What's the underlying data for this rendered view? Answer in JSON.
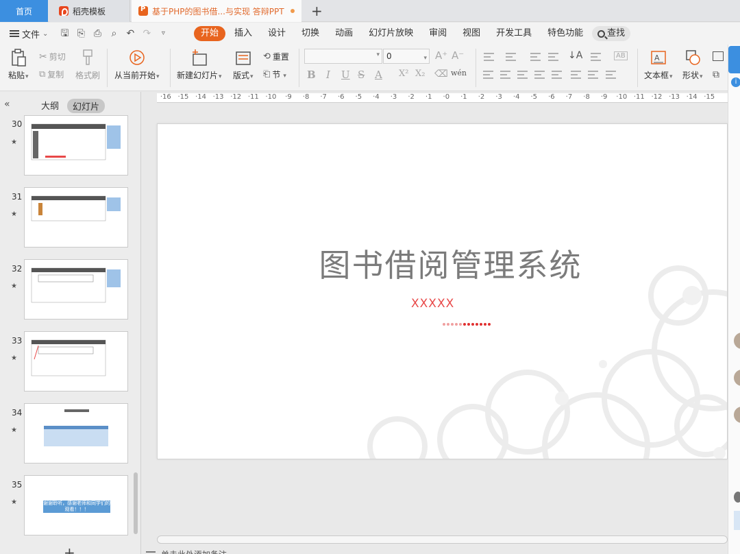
{
  "tabs": {
    "home": "首页",
    "docer": "稻壳模板",
    "document": "基于PHP的图书借...与实现 答辩PPT"
  },
  "menu": {
    "file": "文件",
    "tabs": [
      "开始",
      "插入",
      "设计",
      "切换",
      "动画",
      "幻灯片放映",
      "审阅",
      "视图",
      "开发工具",
      "特色功能"
    ],
    "active_tab": "开始",
    "search": "查找"
  },
  "ribbon": {
    "paste": "粘贴",
    "cut": "剪切",
    "copy": "复制",
    "format_painter": "格式刷",
    "play_from_current": "从当前开始",
    "new_slide": "新建幻灯片",
    "layout": "版式",
    "reset": "重置",
    "section": "节",
    "font_name": "",
    "font_size": "0",
    "text_box": "文本框",
    "shape": "形状"
  },
  "left_panel": {
    "outline_tab": "大纲",
    "slides_tab": "幻灯片",
    "slide_numbers": [
      "30",
      "31",
      "32",
      "33",
      "34",
      "35"
    ]
  },
  "ruler": [
    "16",
    "15",
    "14",
    "13",
    "12",
    "11",
    "10",
    "9",
    "8",
    "7",
    "6",
    "5",
    "4",
    "3",
    "2",
    "1",
    "0",
    "1",
    "2",
    "3",
    "4",
    "5",
    "6",
    "7",
    "8",
    "9",
    "10",
    "11",
    "12",
    "13",
    "14",
    "15"
  ],
  "slide": {
    "title": "图书借阅管理系统",
    "subtitle": "XXXXX",
    "accent_color": "#e84848"
  },
  "thumb_35_text": "谢谢聆听，感谢老师和同学们的观看！！！",
  "notes_placeholder": "单击此处添加备注",
  "colors": {
    "brand_blue": "#3c8fe0",
    "active_orange": "#e8641e"
  }
}
